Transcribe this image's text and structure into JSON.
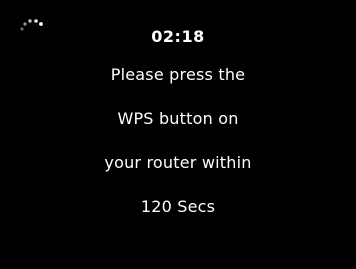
{
  "status": {
    "time": "02:18",
    "icon": "wps-progress-spinner-icon"
  },
  "message": {
    "lines": [
      "Please press the",
      "WPS button on",
      "your router within",
      "120 Secs"
    ]
  },
  "colors": {
    "background": "#000000",
    "text": "#ffffff"
  }
}
